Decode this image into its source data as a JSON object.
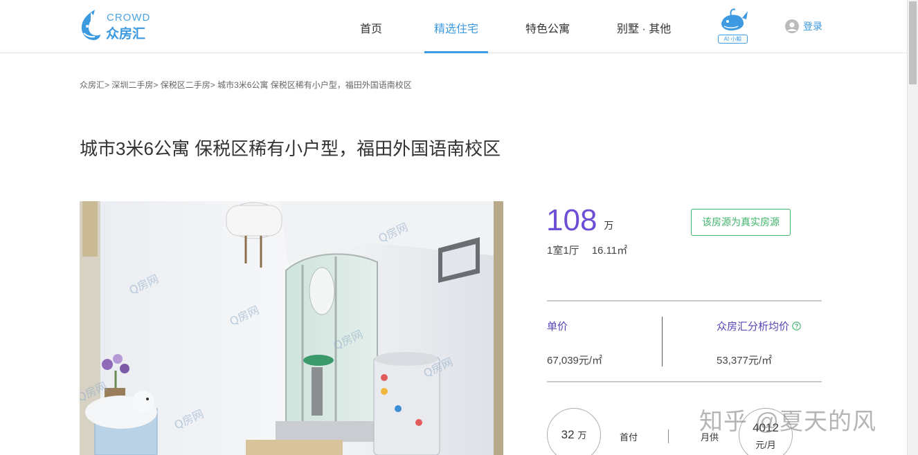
{
  "header": {
    "logo_en": "CROWD",
    "logo_cn": "众房汇",
    "nav": [
      {
        "label": "首页",
        "active": false
      },
      {
        "label": "精选住宅",
        "active": true
      },
      {
        "label": "特色公寓",
        "active": false
      },
      {
        "label": "别墅 · 其他",
        "active": false
      }
    ],
    "ai_label": "AI 小鲸",
    "login_label": "登录"
  },
  "breadcrumb": [
    "众房汇",
    "深圳二手房",
    "保税区二手房",
    "城市3米6公寓 保税区稀有小户型，福田外国语南校区"
  ],
  "listing": {
    "title": "城市3米6公寓 保税区稀有小户型，福田外国语南校区",
    "photo_watermark": "Q房网",
    "price_value": "108",
    "price_unit": "万",
    "verified_label": "该房源为真实房源",
    "layout": "1室1厅",
    "area": "16.11㎡",
    "unit_price_label": "单价",
    "unit_price_value": "67,039元/㎡",
    "avg_price_label": "众房汇分析均价",
    "avg_price_value": "53,377元/㎡",
    "down_payment_amount": "32",
    "down_payment_unit": "万",
    "down_payment_label": "首付",
    "monthly_label": "月供",
    "monthly_amount": "4012",
    "monthly_unit": "元/月"
  },
  "overlay_watermark": "知乎 @夏天的风",
  "colors": {
    "brand_blue": "#3d9ae0",
    "price_purple": "#6c4fd4",
    "verified_green": "#3fb36a"
  },
  "icons": {
    "logo": "whale-logo-icon",
    "ai": "whale-mascot-icon",
    "login": "user-avatar-icon",
    "help": "question-circle-icon"
  }
}
